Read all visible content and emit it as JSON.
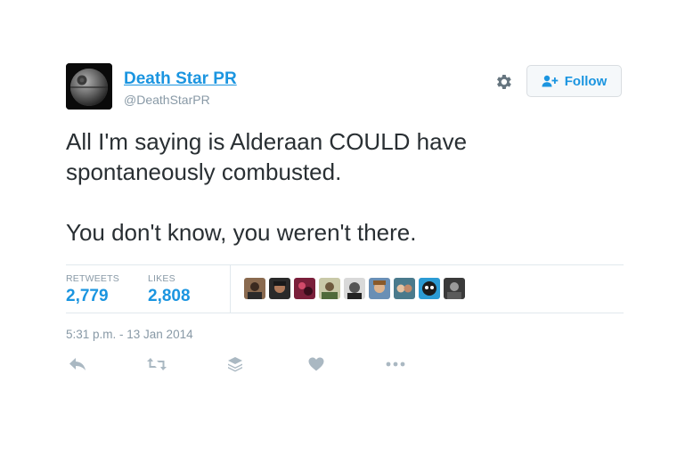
{
  "author": {
    "display_name": "Death Star PR",
    "handle": "@DeathStarPR"
  },
  "header": {
    "follow_label": "Follow",
    "settings_icon": "gear-icon",
    "follow_icon": "add-user-icon"
  },
  "tweet": {
    "paragraphs": [
      "All I'm saying is Alderaan COULD have spontaneously combusted.",
      "You don't know, you weren't there."
    ]
  },
  "stats": {
    "retweets_label": "RETWEETS",
    "retweets_value": "2,779",
    "likes_label": "LIKES",
    "likes_value": "2,808",
    "liker_avatar_count": 9
  },
  "timestamp": "5:31 p.m. - 13 Jan 2014",
  "actions": [
    {
      "name": "reply",
      "icon": "reply-icon"
    },
    {
      "name": "retweet",
      "icon": "retweet-icon"
    },
    {
      "name": "stack",
      "icon": "stack-icon"
    },
    {
      "name": "like",
      "icon": "heart-icon"
    },
    {
      "name": "more",
      "icon": "more-icon"
    }
  ],
  "colors": {
    "accent": "#1b95e0",
    "text": "#292f33",
    "muted": "#8899a6",
    "divider": "#e1e8ed",
    "icon": "#aab8c2"
  }
}
